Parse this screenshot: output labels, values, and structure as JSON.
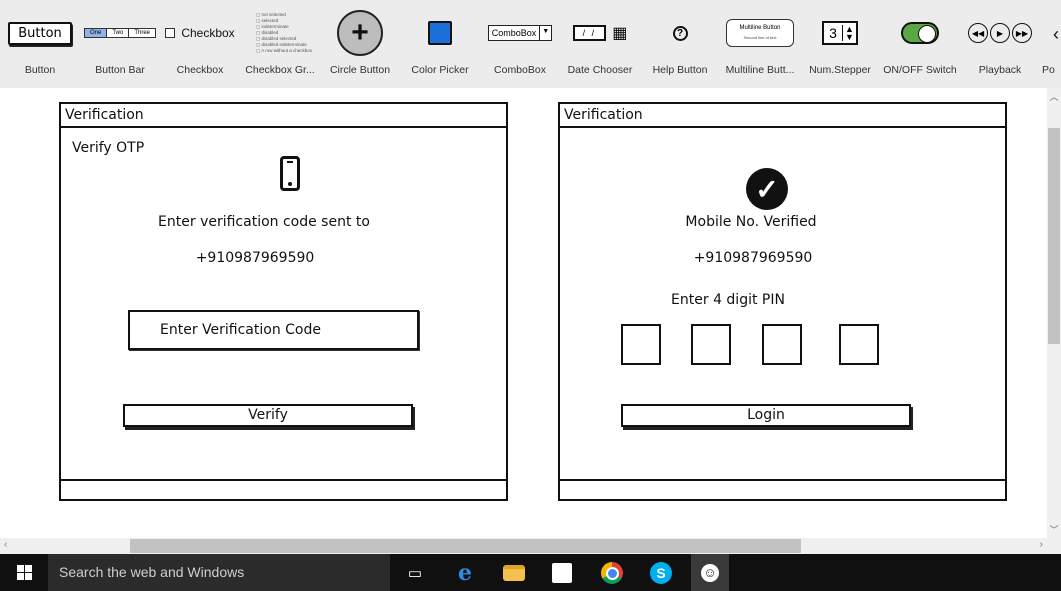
{
  "palette": {
    "items": [
      {
        "label": "Button",
        "preview_text": "Button"
      },
      {
        "label": "Button Bar",
        "segments": [
          "One",
          "Two",
          "Three"
        ]
      },
      {
        "label": "Checkbox",
        "preview_text": "Checkbox"
      },
      {
        "label": "Checkbox Gr...",
        "options": [
          "not selected",
          "selected",
          "indeterminate",
          "disabled",
          "disabled selected",
          "disabled indeterminate",
          "A row without a checkbox"
        ]
      },
      {
        "label": "Circle Button",
        "preview_text": "+"
      },
      {
        "label": "Color Picker"
      },
      {
        "label": "ComboBox",
        "preview_text": "ComboBox"
      },
      {
        "label": "Date Chooser",
        "preview_text": "/ /"
      },
      {
        "label": "Help Button",
        "preview_text": "?"
      },
      {
        "label": "Multiline Butt...",
        "preview_line1": "Multiline Button",
        "preview_line2": "Second line of text"
      },
      {
        "label": "Num.Stepper",
        "preview_text": "3"
      },
      {
        "label": "ON/OFF Switch"
      },
      {
        "label": "Playback"
      },
      {
        "label": "Po"
      }
    ],
    "colors": {
      "color_picker": "#1c6fd8",
      "switch_on": "#5aa845",
      "button_bar_active": "#8fb3e8"
    }
  },
  "left_window": {
    "title": "Verification",
    "heading": "Verify OTP",
    "icon": "mobile-phone-icon",
    "instruction": "Enter verification code sent to",
    "phone_number": "+910987969590",
    "input_placeholder": "Enter Verification Code",
    "action_label": "Verify"
  },
  "right_window": {
    "title": "Verification",
    "icon": "check-circle-icon",
    "status": "Mobile No. Verified",
    "phone_number": "+910987969590",
    "pin_label": "Enter 4 digit PIN",
    "pin_digits": 4,
    "action_label": "Login"
  },
  "taskbar": {
    "search_placeholder": "Search the web and Windows",
    "pinned_apps": [
      "task-view",
      "edge",
      "file-explorer",
      "store",
      "chrome",
      "skype",
      "balsamiq"
    ]
  }
}
